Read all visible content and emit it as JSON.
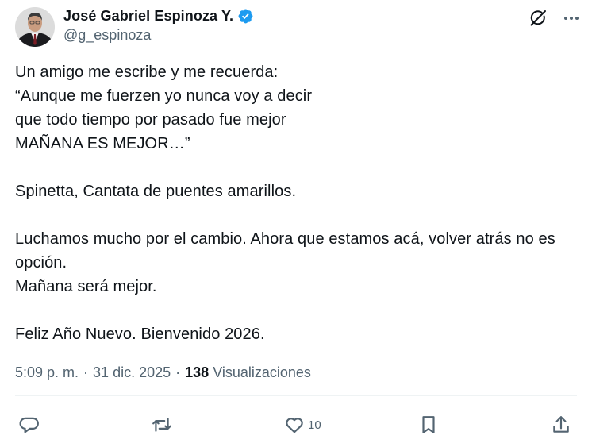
{
  "author": {
    "display_name": "José Gabriel Espinoza Y.",
    "handle": "@g_espinoza",
    "verified": true,
    "verified_color": "#1d9bf0"
  },
  "tweet": {
    "text": "Un amigo me escribe y me recuerda:\n“Aunque me fuerzen yo nunca voy a decir\nque todo tiempo por pasado fue mejor\nMAÑANA ES MEJOR…”\n\nSpinetta, Cantata de puentes amarillos.\n\nLuchamos mucho por el cambio. Ahora que estamos acá, volver atrás no es opción.\nMañana será mejor.\n\nFeliz Año Nuevo. Bienvenido 2026."
  },
  "meta": {
    "time": "5:09 p. m.",
    "separator": "·",
    "date": "31 dic. 2025",
    "views_count": "138",
    "views_label": "Visualizaciones"
  },
  "actions": {
    "reply": {
      "icon": "reply-icon",
      "count": ""
    },
    "repost": {
      "icon": "repost-icon",
      "count": ""
    },
    "like": {
      "icon": "heart-icon",
      "count": "10"
    },
    "bookmark": {
      "icon": "bookmark-icon",
      "count": ""
    },
    "share": {
      "icon": "share-icon",
      "count": ""
    }
  },
  "colors": {
    "text": "#0f1419",
    "secondary": "#536471",
    "divider": "#eff3f4"
  }
}
